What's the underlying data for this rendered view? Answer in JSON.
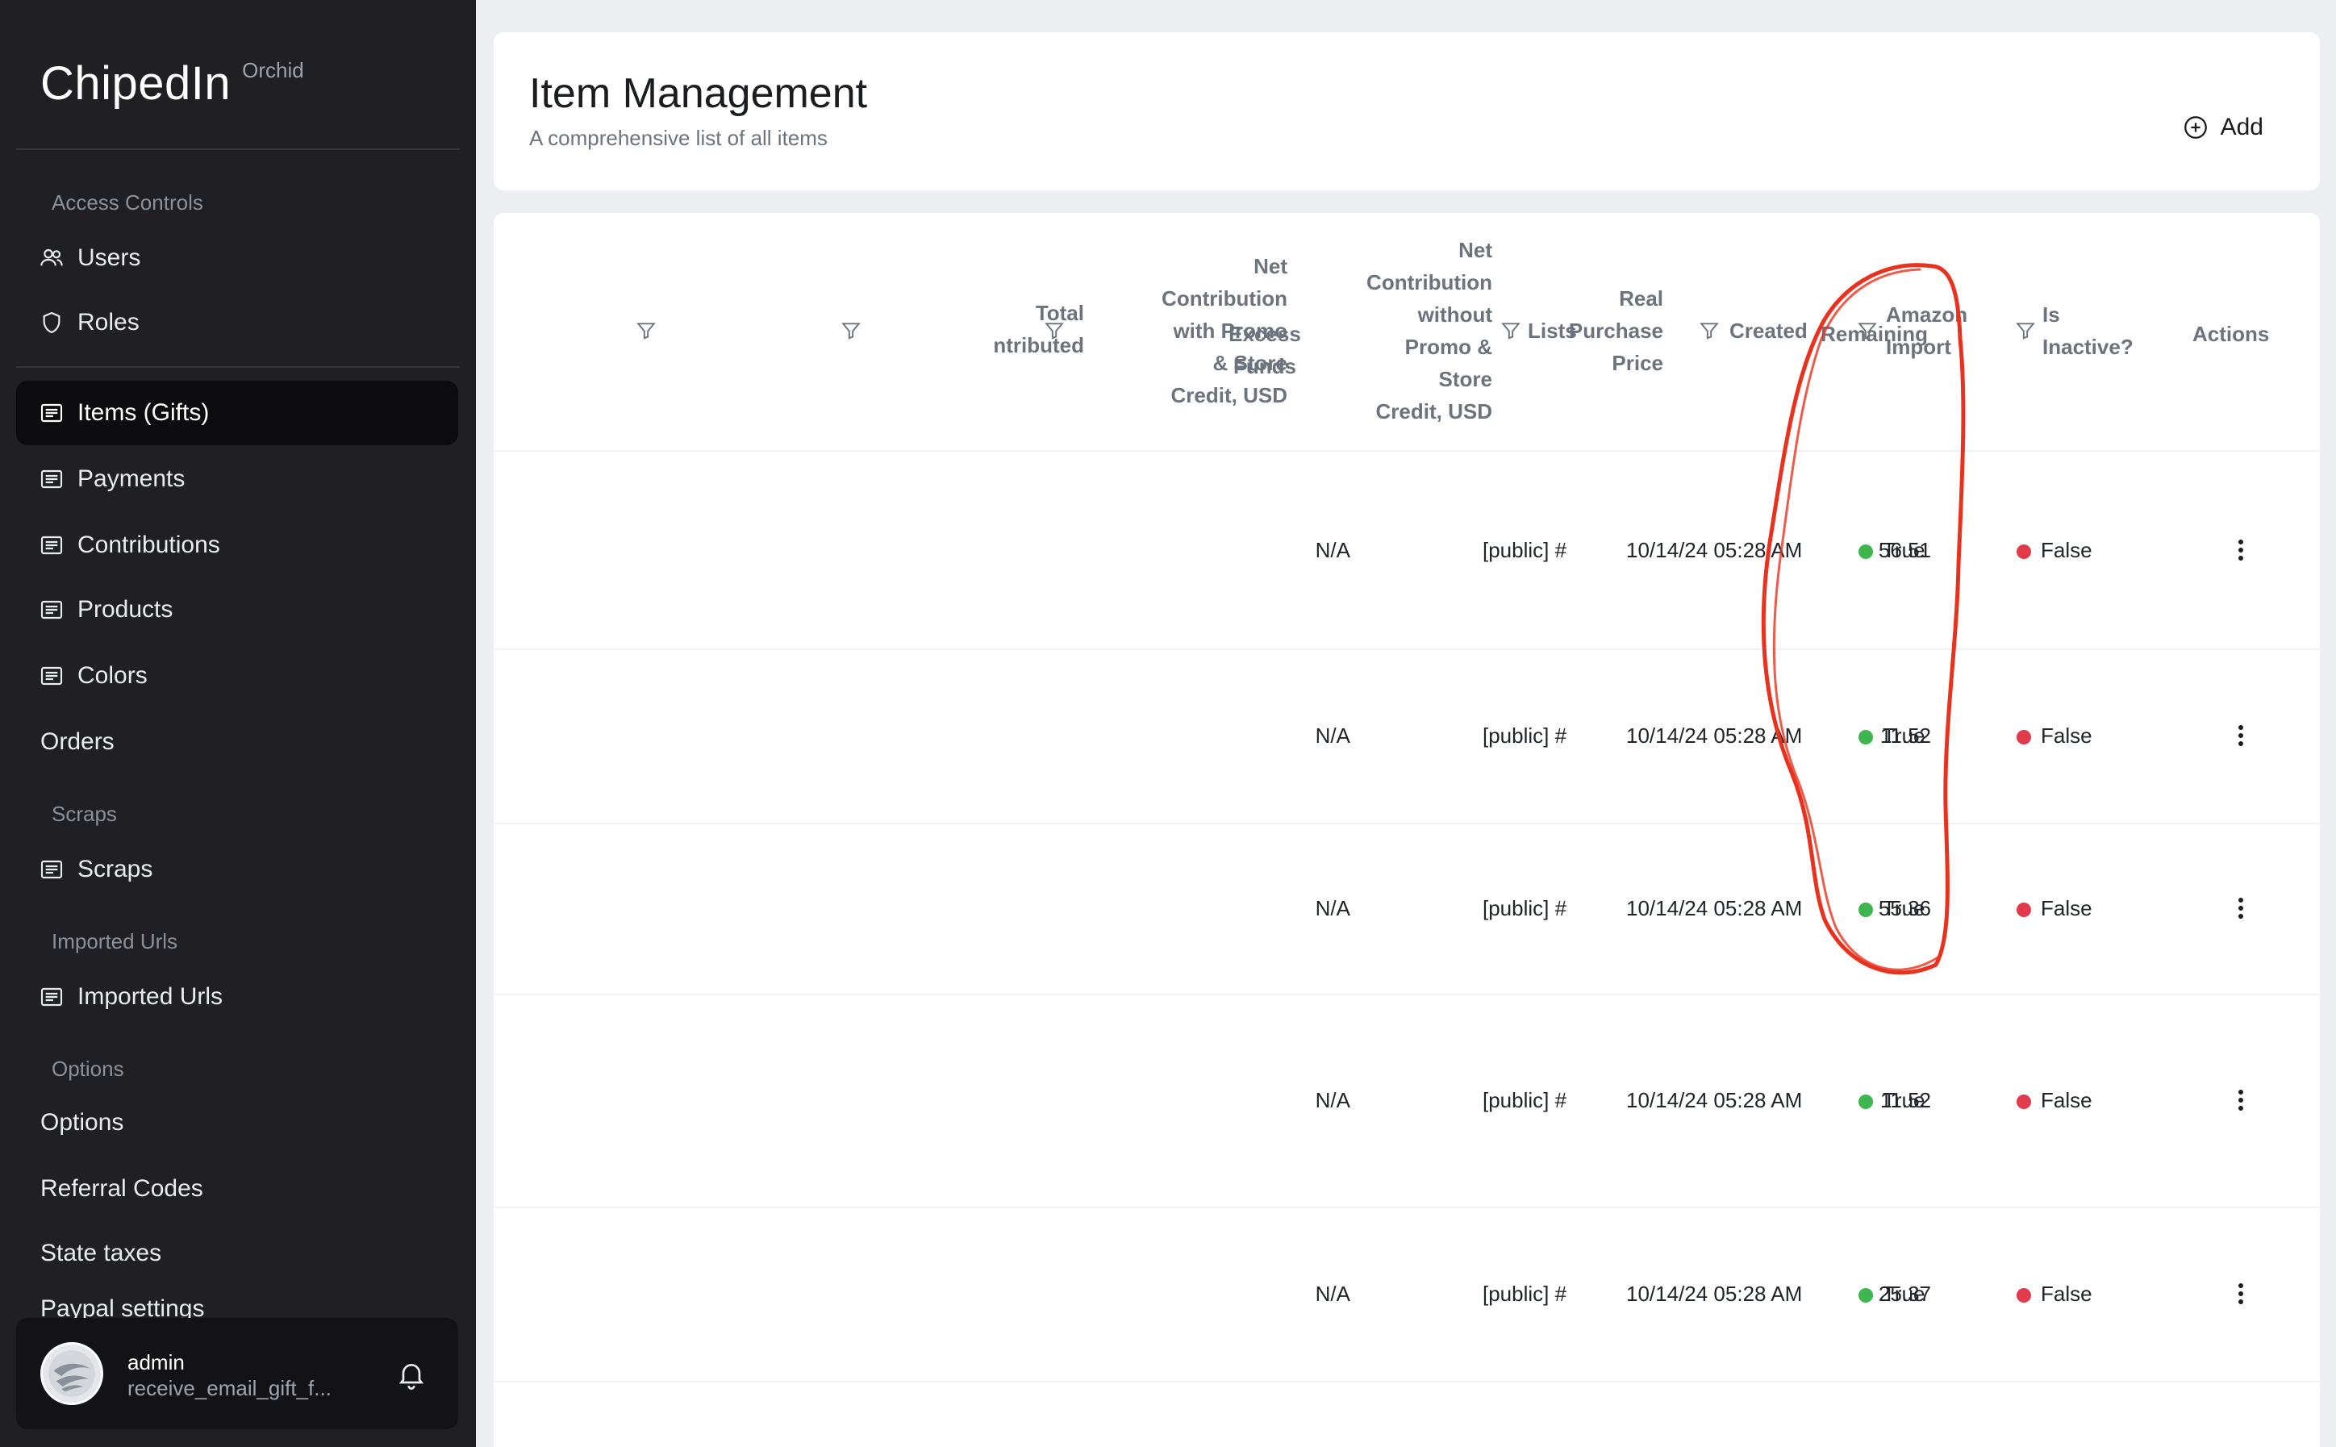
{
  "app": {
    "name": "ChipedIn",
    "subtitle": "Orchid"
  },
  "sidebar": {
    "sections": {
      "access": "Access Controls",
      "scraps": "Scraps",
      "imported": "Imported Urls",
      "options": "Options"
    },
    "items": {
      "users": "Users",
      "roles": "Roles",
      "items": "Items (Gifts)",
      "payments": "Payments",
      "contributions": "Contributions",
      "products": "Products",
      "colors": "Colors",
      "orders": "Orders",
      "scraps": "Scraps",
      "imported_urls": "Imported Urls",
      "options": "Options",
      "referral_codes": "Referral Codes",
      "state_taxes": "State taxes",
      "paypal_settings": "Paypal settings"
    },
    "user": {
      "name": "admin",
      "email": "receive_email_gift_f..."
    }
  },
  "header": {
    "title": "Item Management",
    "subtitle": "A comprehensive list of all items",
    "add_label": "Add"
  },
  "table": {
    "columns": {
      "total": [
        "Total",
        "ntributed"
      ],
      "net_with": [
        "Net",
        "Contribution",
        "with Promo",
        "& Store",
        "Credit, USD"
      ],
      "net_without": [
        "Net",
        "Contribution",
        "without",
        "Promo &",
        "Store",
        "Credit, USD"
      ],
      "real_purchase": [
        "Real",
        "Purchase",
        "Price"
      ],
      "excess": [
        "Excess",
        "Funds"
      ],
      "remaining": "Remaining",
      "lists": "Lists",
      "created": "Created",
      "amazon": [
        "Amazon",
        "Import"
      ],
      "inactive": [
        "Is",
        "Inactive?"
      ],
      "actions": "Actions"
    },
    "rows": [
      {
        "excess": "N/A",
        "remaining": "56.51",
        "lists": "[public] #",
        "created": "10/14/24 05:28 AM",
        "amazon": "True",
        "inactive": "False"
      },
      {
        "excess": "N/A",
        "remaining": "11.52",
        "lists": "[public] #",
        "created": "10/14/24 05:28 AM",
        "amazon": "True",
        "inactive": "False"
      },
      {
        "excess": "N/A",
        "remaining": "55.36",
        "lists": "[public] #",
        "created": "10/14/24 05:28 AM",
        "amazon": "True",
        "inactive": "False"
      },
      {
        "excess": "N/A",
        "remaining": "11.52",
        "lists": "[public] #",
        "created": "10/14/24 05:28 AM",
        "amazon": "True",
        "inactive": "False"
      },
      {
        "excess": "N/A",
        "remaining": "25.37",
        "lists": "[public] #",
        "created": "10/14/24 05:28 AM",
        "amazon": "True",
        "inactive": "False"
      }
    ]
  },
  "colors": {
    "sidebar_bg": "#1f1f24",
    "status_true": "#3fb550",
    "status_false": "#e03a4b",
    "annotation": "#e8321e"
  }
}
